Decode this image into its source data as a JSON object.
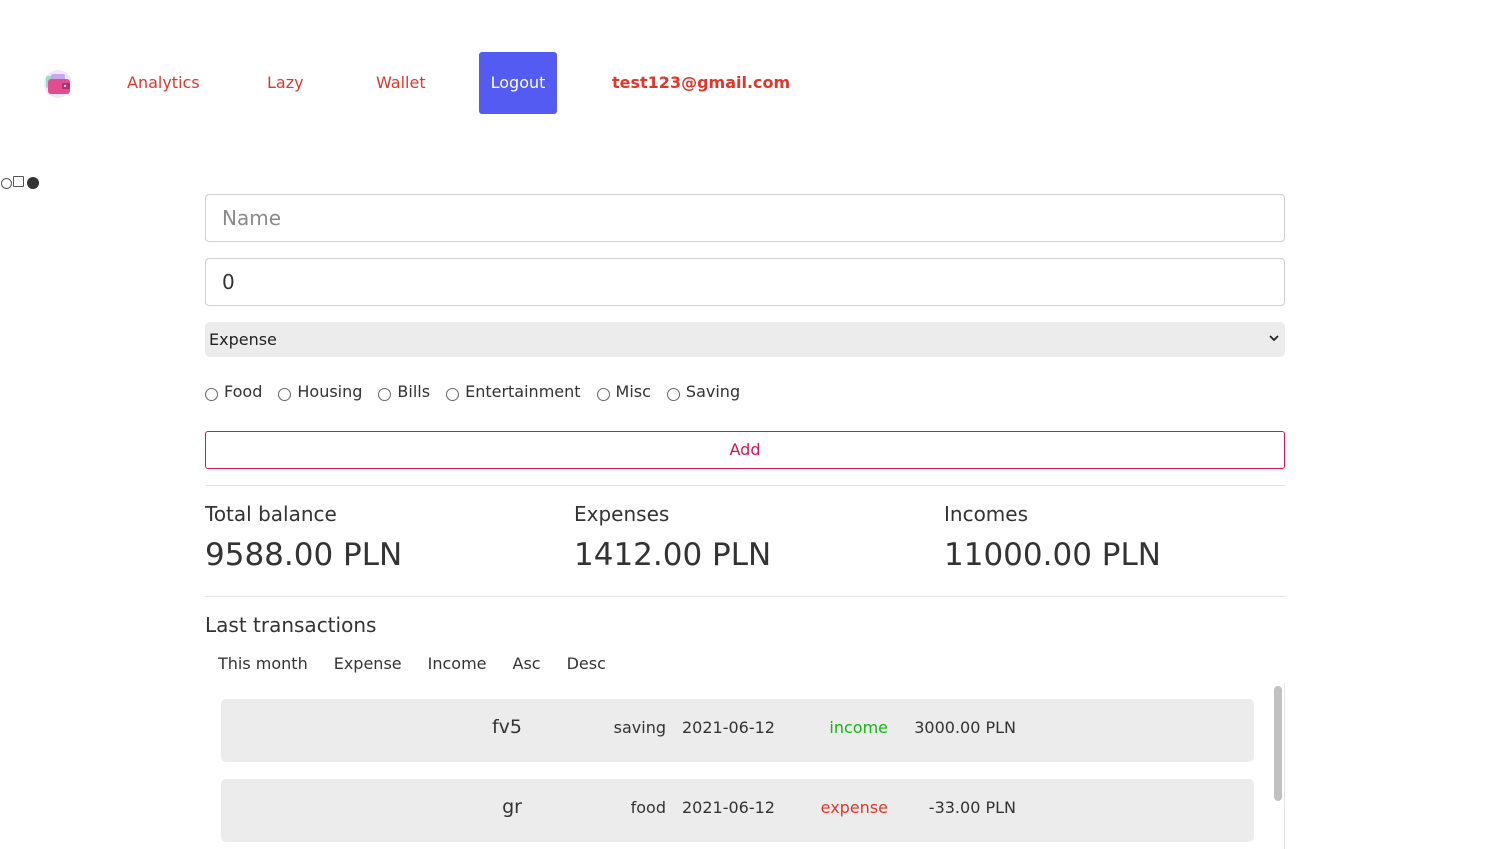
{
  "nav": {
    "logo_icon": "wallet-logo-icon",
    "links": [
      "Analytics",
      "Lazy",
      "Wallet"
    ],
    "logout_label": "Logout",
    "user_email": "test123@gmail.com",
    "accent_color": "#535bf2",
    "link_color": "#e0372d"
  },
  "form": {
    "name_placeholder": "Name",
    "amount_value": "0",
    "type_selected": "Expense",
    "categories": [
      "Food",
      "Housing",
      "Bills",
      "Entertainment",
      "Misc",
      "Saving"
    ],
    "add_label": "Add"
  },
  "stats": {
    "total_label": "Total balance",
    "total_value": "9588.00 PLN",
    "expenses_label": "Expenses",
    "expenses_value": "1412.00 PLN",
    "incomes_label": "Incomes",
    "incomes_value": "11000.00 PLN"
  },
  "transactions": {
    "title": "Last transactions",
    "filters": [
      "This month",
      "Expense",
      "Income",
      "Asc",
      "Desc"
    ],
    "rows": [
      {
        "name": "fv5",
        "category": "saving",
        "date": "2021-06-12",
        "type": "income",
        "amount": "3000.00 PLN"
      },
      {
        "name": "gr",
        "category": "food",
        "date": "2021-06-12",
        "type": "expense",
        "amount": "-33.00 PLN"
      }
    ]
  }
}
